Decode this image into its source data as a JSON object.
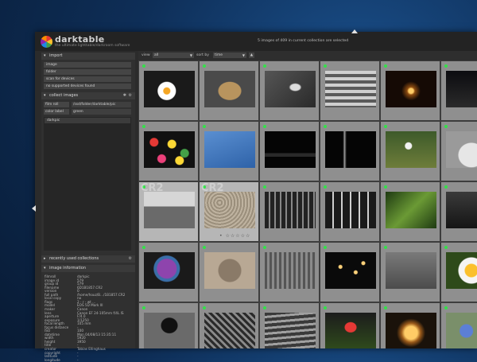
{
  "app": {
    "name": "darktable",
    "tagline": "the ultimate lighttable/darkroom software",
    "status": "5 images of 409 in current collection are selected"
  },
  "import": {
    "title": "import",
    "buttons": [
      "image",
      "folder",
      "scan for devices",
      "no supported devices found"
    ]
  },
  "collect": {
    "title": "collect images",
    "rules": [
      {
        "type": "film roll",
        "value": "/ssd/folder/darktable/pic"
      },
      {
        "type": "color label",
        "value": "green"
      }
    ],
    "items": [
      "darkpic"
    ]
  },
  "recent": {
    "title": "recently used collections"
  },
  "info": {
    "title": "image information",
    "rows": [
      {
        "k": "filmroll",
        "v": "darkpic"
      },
      {
        "k": "image id",
        "v": "579"
      },
      {
        "k": "group id",
        "v": "579"
      },
      {
        "k": "filename",
        "v": "6D1B1857.CR2"
      },
      {
        "k": "version",
        "v": "0"
      },
      {
        "k": "full path",
        "v": "/home/houz/B.../1B1857.CR2"
      },
      {
        "k": "local copy",
        "v": "no"
      },
      {
        "k": "flags",
        "v": "2 - r - wt ..."
      },
      {
        "k": "model",
        "v": "EOS 5D Mark III"
      },
      {
        "k": "maker",
        "v": "Canon"
      },
      {
        "k": "lens",
        "v": "Canon EF 24-105mm f/4L IS"
      },
      {
        "k": "aperture",
        "v": "F/4.0"
      },
      {
        "k": "exposure",
        "v": "1/1250"
      },
      {
        "k": "focal length",
        "v": "105 mm"
      },
      {
        "k": "focus distance",
        "v": "-"
      },
      {
        "k": "ISO",
        "v": "100"
      },
      {
        "k": "datetime",
        "v": "Mon 04/08/13 15:35:11"
      },
      {
        "k": "width",
        "v": "5920"
      },
      {
        "k": "height",
        "v": "3950"
      },
      {
        "k": "title",
        "v": "-"
      },
      {
        "k": "creator",
        "v": "Tobias Ellinghaus"
      },
      {
        "k": "copyright",
        "v": "-"
      },
      {
        "k": "latitude",
        "v": "-"
      },
      {
        "k": "longitude",
        "v": "-"
      }
    ]
  },
  "filter": {
    "view_label": "view",
    "view_value": "all",
    "sort_label": "sort by",
    "sort_value": "time",
    "sort_dir": "▲"
  },
  "grid": {
    "ext": "CR2",
    "stars": "• ☆☆☆☆☆",
    "rows": [
      [
        {
          "thumb": "egg-in-pan",
          "sel": false
        },
        {
          "thumb": "dove-figurine",
          "sel": false
        },
        {
          "thumb": "glass-lightbulb",
          "sel": false
        },
        {
          "thumb": "building-stairs-bw",
          "sel": false
        },
        {
          "thumb": "dark-lamp",
          "sel": false
        },
        {
          "thumb": "dark-night",
          "sel": false
        }
      ],
      [
        {
          "thumb": "colorful-candies",
          "sel": false
        },
        {
          "thumb": "catkins-sky",
          "sel": false
        },
        {
          "thumb": "dark-car",
          "sel": false
        },
        {
          "thumb": "light-streak",
          "sel": false
        },
        {
          "thumb": "snowdrops",
          "sel": false
        },
        {
          "thumb": "sink-bw",
          "sel": false
        }
      ],
      [
        {
          "thumb": "street-bw",
          "sel": true
        },
        {
          "thumb": "gravel-texture",
          "sel": true
        },
        {
          "thumb": "building-grid-bw",
          "sel": false
        },
        {
          "thumb": "hooks-bw",
          "sel": false
        },
        {
          "thumb": "fern-leaves",
          "sel": false
        },
        {
          "thumb": "dark-sculpture",
          "sel": false
        }
      ],
      [
        {
          "thumb": "purple-hair",
          "sel": false
        },
        {
          "thumb": "airport-sign",
          "sel": false
        },
        {
          "thumb": "chairs-bw",
          "sel": false
        },
        {
          "thumb": "lights-dark",
          "sel": false
        },
        {
          "thumb": "wall-sign",
          "sel": false
        },
        {
          "thumb": "yellow-flower",
          "sel": false
        }
      ],
      [
        {
          "thumb": "arch-window-bw",
          "sel": false
        },
        {
          "thumb": "pattern-bw",
          "sel": false
        },
        {
          "thumb": "steps-bw",
          "sel": false
        },
        {
          "thumb": "red-tulips",
          "sel": false
        },
        {
          "thumb": "candle-jar",
          "sel": false
        },
        {
          "thumb": "blue-flowers",
          "sel": false
        }
      ]
    ]
  },
  "colors": {
    "accent": "#35e04a",
    "panel": "#303030",
    "center": "#343434",
    "cell": "#8f8f8f",
    "cell_selected": "#b6b6b6"
  }
}
